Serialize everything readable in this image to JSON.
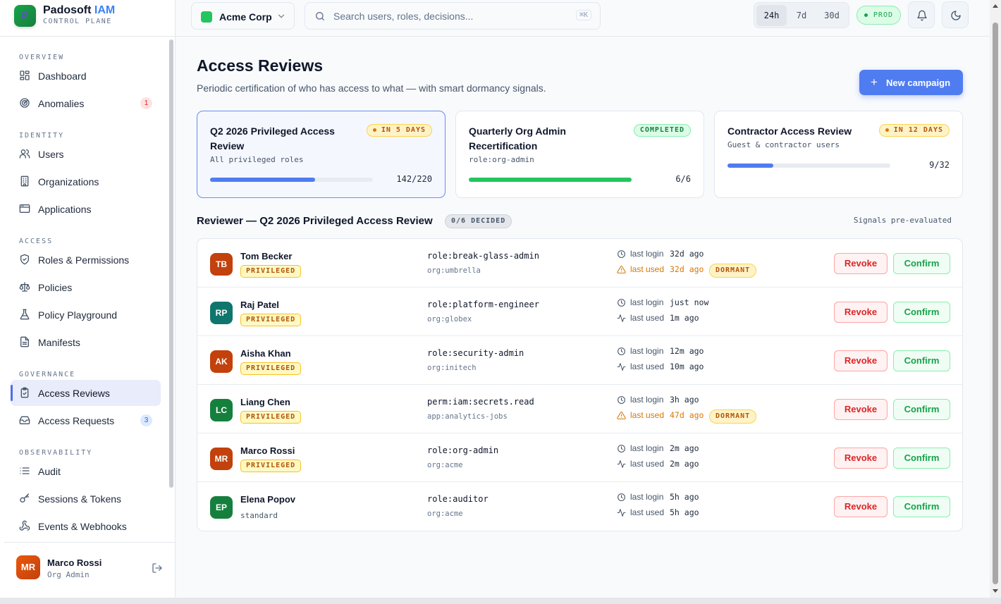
{
  "brand": {
    "name": "Padosoft ",
    "name_accent": "IAM",
    "subtitle": "CONTROL PLANE",
    "logo_letter": "P"
  },
  "sidebar": {
    "sections": [
      {
        "label": "OVERVIEW",
        "items": [
          {
            "label": "Dashboard",
            "icon": "dashboard-icon"
          },
          {
            "label": "Anomalies",
            "icon": "radar-icon",
            "badge": "1",
            "badge_color": "#dc2626"
          }
        ]
      },
      {
        "label": "IDENTITY",
        "items": [
          {
            "label": "Users",
            "icon": "users-icon"
          },
          {
            "label": "Organizations",
            "icon": "building-icon"
          },
          {
            "label": "Applications",
            "icon": "app-window-icon"
          }
        ]
      },
      {
        "label": "ACCESS",
        "items": [
          {
            "label": "Roles & Permissions",
            "icon": "shield-check-icon"
          },
          {
            "label": "Policies",
            "icon": "scale-icon"
          },
          {
            "label": "Policy Playground",
            "icon": "flask-icon"
          },
          {
            "label": "Manifests",
            "icon": "file-text-icon"
          }
        ]
      },
      {
        "label": "GOVERNANCE",
        "items": [
          {
            "label": "Access Reviews",
            "icon": "clipboard-check-icon",
            "active": true
          },
          {
            "label": "Access Requests",
            "icon": "inbox-icon",
            "badge": "3",
            "badge_color": "#2563eb"
          }
        ]
      },
      {
        "label": "OBSERVABILITY",
        "items": [
          {
            "label": "Audit",
            "icon": "list-icon"
          },
          {
            "label": "Sessions & Tokens",
            "icon": "key-icon"
          },
          {
            "label": "Events & Webhooks",
            "icon": "webhook-icon"
          }
        ]
      }
    ],
    "user": {
      "initials": "MR",
      "name": "Marco Rossi",
      "role": "Org Admin"
    }
  },
  "topbar": {
    "org": "Acme Corp",
    "search_placeholder": "Search users, roles, decisions...",
    "search_shortcut": "⌘K",
    "ranges": [
      "24h",
      "7d",
      "30d"
    ],
    "active_range": "24h",
    "env": "PROD"
  },
  "page": {
    "title": "Access Reviews",
    "subtitle": "Periodic certification of who has access to what — with smart dormancy signals.",
    "new_button": "New campaign",
    "plus": "+"
  },
  "campaigns": [
    {
      "title": "Q2 2026 Privileged Access Review",
      "scope": "All privileged roles",
      "badge": "IN 5 DAYS",
      "badge_kind": "due",
      "done": 142,
      "total": 220,
      "count": "142/220",
      "progress": 0.645,
      "bar_color": "#4f7cf0",
      "selected": true
    },
    {
      "title": "Quarterly Org Admin Recertification",
      "scope": "role:org-admin",
      "badge": "COMPLETED",
      "badge_kind": "done",
      "done": 6,
      "total": 6,
      "count": "6/6",
      "progress": 1.0,
      "bar_color": "#22c55e",
      "selected": false
    },
    {
      "title": "Contractor Access Review",
      "scope": "Guest & contractor users",
      "badge": "IN 12 DAYS",
      "badge_kind": "due",
      "done": 9,
      "total": 32,
      "count": "9/32",
      "progress": 0.28,
      "bar_color": "#4f7cf0",
      "selected": false
    }
  ],
  "reviewer": {
    "title": "Reviewer — Q2 2026 Privileged Access Review",
    "decided": "0/6 DECIDED",
    "signals_note": "Signals pre-evaluated",
    "login_label": "last login",
    "used_label": "last used",
    "dormant_label": "DORMANT",
    "revoke_label": "Revoke",
    "confirm_label": "Confirm",
    "rows": [
      {
        "initials": "TB",
        "name": "Tom Becker",
        "tag": "PRIVILEGED",
        "role": "role:break-glass-admin",
        "scope": "org:umbrella",
        "last_login": "32d ago",
        "last_used": "32d ago",
        "dormant": true,
        "color": "#c2410c"
      },
      {
        "initials": "RP",
        "name": "Raj Patel",
        "tag": "PRIVILEGED",
        "role": "role:platform-engineer",
        "scope": "org:globex",
        "last_login": "just now",
        "last_used": "1m ago",
        "dormant": false,
        "color": "#0f766e"
      },
      {
        "initials": "AK",
        "name": "Aisha Khan",
        "tag": "PRIVILEGED",
        "role": "role:security-admin",
        "scope": "org:initech",
        "last_login": "12m ago",
        "last_used": "10m ago",
        "dormant": false,
        "color": "#c2410c"
      },
      {
        "initials": "LC",
        "name": "Liang Chen",
        "tag": "PRIVILEGED",
        "role": "perm:iam:secrets.read",
        "scope": "app:analytics-jobs",
        "last_login": "3h ago",
        "last_used": "47d ago",
        "dormant": true,
        "color": "#15803d"
      },
      {
        "initials": "MR",
        "name": "Marco Rossi",
        "tag": "PRIVILEGED",
        "role": "role:org-admin",
        "scope": "org:acme",
        "last_login": "2m ago",
        "last_used": "2m ago",
        "dormant": false,
        "color": "#c2410c"
      },
      {
        "initials": "EP",
        "name": "Elena Popov",
        "tag": "standard",
        "role": "role:auditor",
        "scope": "org:acme",
        "last_login": "5h ago",
        "last_used": "5h ago",
        "dormant": false,
        "color": "#15803d"
      }
    ]
  }
}
